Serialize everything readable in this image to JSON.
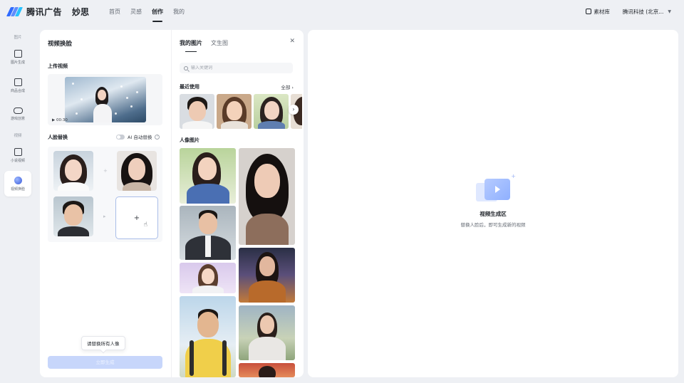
{
  "header": {
    "logo_text": "腾讯广告",
    "product": "妙思",
    "nav": [
      {
        "label": "首页",
        "active": false
      },
      {
        "label": "灵感",
        "active": false
      },
      {
        "label": "创作",
        "active": true
      },
      {
        "label": "我的",
        "active": false
      }
    ],
    "material_label": "素材库",
    "account_label": "腾讯科技 (北京..."
  },
  "rail": {
    "section1": "图片",
    "items1": [
      {
        "label": "图片生成",
        "icon": "image-edit-icon"
      },
      {
        "label": "商品合成",
        "icon": "product-icon"
      },
      {
        "label": "游戏创意",
        "icon": "gamepad-icon"
      }
    ],
    "section2": "视频",
    "items2": [
      {
        "label": "小说视频",
        "icon": "play-square-icon"
      },
      {
        "label": "视频换脸",
        "icon": "face-swap-sphere-icon",
        "active": true
      }
    ]
  },
  "left_panel": {
    "title": "视频换脸",
    "upload_label": "上传视频",
    "video_duration": "▶ 00:30",
    "face_swap_label": "人脸替换",
    "ai_toggle_label": "AI 自动替换",
    "ai_toggle_on": false,
    "tooltip": "请替换所有人像",
    "generate_button": "立即生成"
  },
  "mid_panel": {
    "tabs": [
      "我的图片",
      "文生图"
    ],
    "active_tab": 0,
    "search_placeholder": "输入关键词",
    "recent_label": "最近使用",
    "recent_all": "全部",
    "portrait_label": "人像图片"
  },
  "right_panel": {
    "empty_title": "视频生成区",
    "empty_subtitle": "替换人脸后，即可生成新的视频"
  },
  "colors": {
    "accent": "#2f6bff",
    "button_disabled": "#c7d6fb",
    "slot_border": "#a9bde8",
    "background": "#eef0f4"
  }
}
